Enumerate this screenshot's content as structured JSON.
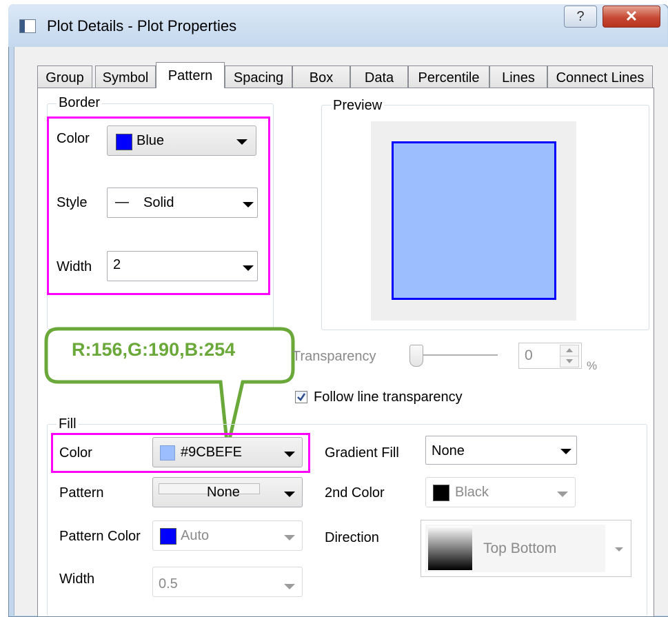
{
  "window": {
    "title": "Plot Details - Plot Properties",
    "help_label": "?",
    "close_label": "✕"
  },
  "tabs": [
    {
      "label": "Group"
    },
    {
      "label": "Symbol"
    },
    {
      "label": "Pattern"
    },
    {
      "label": "Spacing"
    },
    {
      "label": "Box"
    },
    {
      "label": "Data"
    },
    {
      "label": "Percentile"
    },
    {
      "label": "Lines"
    },
    {
      "label": "Connect Lines"
    }
  ],
  "active_tab": "Pattern",
  "border": {
    "title": "Border",
    "color_label": "Color",
    "color_value": "Blue",
    "color_hex": "#0000ff",
    "style_label": "Style",
    "style_glyph": "—",
    "style_value": "Solid",
    "width_label": "Width",
    "width_value": "2"
  },
  "preview": {
    "title": "Preview",
    "fill_color": "#9cbefe",
    "border_color": "#0000ff"
  },
  "callout": {
    "text": "R:156,G:190,B:254",
    "color": "#6aa83a"
  },
  "transparency": {
    "label": "Transparency",
    "value": "0",
    "unit": "%",
    "level": 0
  },
  "follow_line_transparency": {
    "label": "Follow line transparency",
    "checked": true
  },
  "fill": {
    "title": "Fill",
    "color_label": "Color",
    "color_value": "#9CBEFE",
    "color_hex": "#9cbefe",
    "pattern_label": "Pattern",
    "pattern_value": "None",
    "pattern_color_label": "Pattern Color",
    "pattern_color_value": "Auto",
    "pattern_color_hex": "#0000ff",
    "width_label": "Width",
    "width_value": "0.5",
    "gradient_label": "Gradient Fill",
    "gradient_value": "None",
    "second_color_label": "2nd Color",
    "second_color_value": "Black",
    "second_color_hex": "#000000",
    "direction_label": "Direction",
    "direction_value": "Top Bottom"
  }
}
